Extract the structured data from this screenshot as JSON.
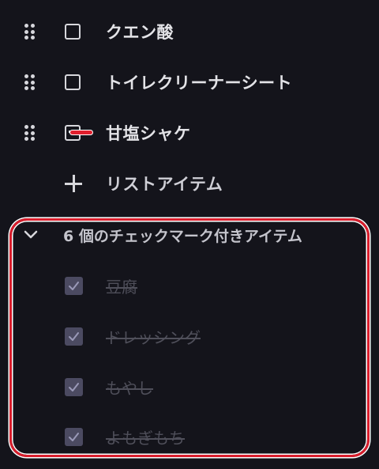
{
  "unchecked_items": [
    {
      "label": "クエン酸"
    },
    {
      "label": "トイレクリーナーシート"
    },
    {
      "label": "甘塩シャケ"
    }
  ],
  "add_item": {
    "label": "リストアイテム"
  },
  "checked_section": {
    "title": "6 個のチェックマーク付きアイテム",
    "items": [
      {
        "label": "豆腐"
      },
      {
        "label": "ドレッシング"
      },
      {
        "label": "もやし"
      },
      {
        "label": "よもぎもち"
      }
    ]
  },
  "colors": {
    "background": "#14141b",
    "highlight": "#d91d2c"
  }
}
